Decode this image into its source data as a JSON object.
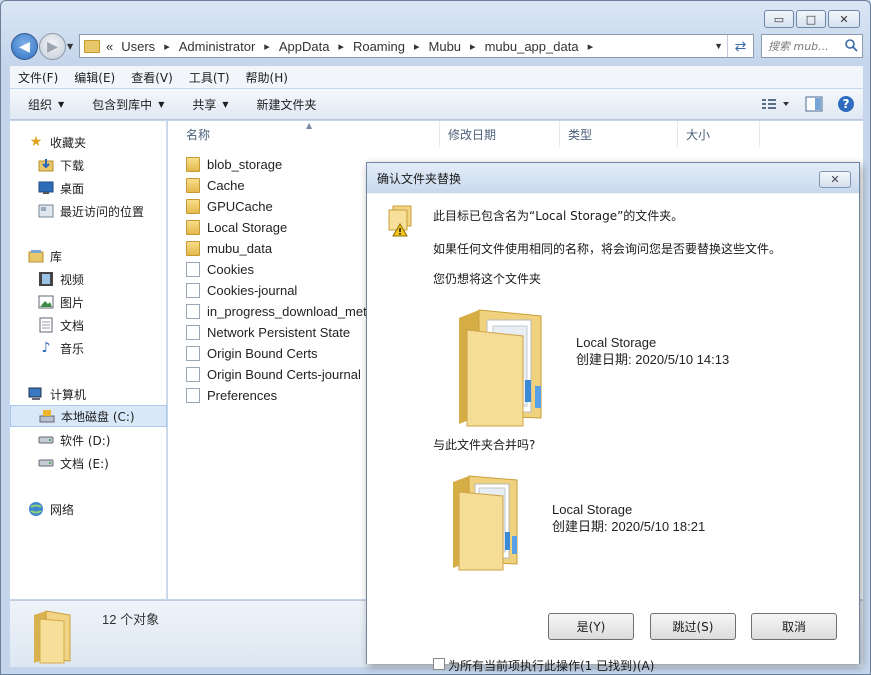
{
  "window": {
    "caption": {
      "minimize": "▭",
      "maximize": "□",
      "close": "✕"
    }
  },
  "address": {
    "overflow": "«",
    "crumbs": [
      "Users",
      "Administrator",
      "AppData",
      "Roaming",
      "Mubu",
      "mubu_app_data"
    ],
    "sep": "▸",
    "search_placeholder": "搜索 mub..."
  },
  "menu": [
    "文件(F)",
    "编辑(E)",
    "查看(V)",
    "工具(T)",
    "帮助(H)"
  ],
  "toolbar": {
    "organize": "组织",
    "include_library": "包含到库中",
    "share": "共享",
    "new_folder": "新建文件夹"
  },
  "nav": {
    "favorites": "收藏夹",
    "downloads": "下载",
    "desktop": "桌面",
    "recent": "最近访问的位置",
    "libraries": "库",
    "videos": "视频",
    "pictures": "图片",
    "documents": "文档",
    "music": "音乐",
    "computer": "计算机",
    "drive_c": "本地磁盘 (C:)",
    "drive_d": "软件 (D:)",
    "drive_e": "文档 (E:)",
    "network": "网络"
  },
  "columns": {
    "name": "名称",
    "modified": "修改日期",
    "type": "类型",
    "size": "大小"
  },
  "files": [
    {
      "name": "blob_storage",
      "kind": "folder"
    },
    {
      "name": "Cache",
      "kind": "folder"
    },
    {
      "name": "GPUCache",
      "kind": "folder"
    },
    {
      "name": "Local Storage",
      "kind": "folder"
    },
    {
      "name": "mubu_data",
      "kind": "folder"
    },
    {
      "name": "Cookies",
      "kind": "file"
    },
    {
      "name": "Cookies-journal",
      "kind": "file"
    },
    {
      "name": "in_progress_download_met",
      "kind": "file"
    },
    {
      "name": "Network Persistent State",
      "kind": "file"
    },
    {
      "name": "Origin Bound Certs",
      "kind": "file"
    },
    {
      "name": "Origin Bound Certs-journal",
      "kind": "file"
    },
    {
      "name": "Preferences",
      "kind": "file"
    }
  ],
  "status": {
    "count": "12 个对象"
  },
  "dialog": {
    "title": "确认文件夹替换",
    "close": "✕",
    "line1": "此目标已包含名为“Local Storage”的文件夹。",
    "line2": "如果任何文件使用相同的名称，将会询问您是否要替换这些文件。",
    "line3": "您仍想将这个文件夹",
    "dest": {
      "name": "Local Storage",
      "created": "创建日期: 2020/5/10 14:13"
    },
    "merge_question": "与此文件夹合并吗?",
    "source": {
      "name": "Local Storage",
      "created": "创建日期: 2020/5/10 18:21"
    },
    "yes": "是(Y)",
    "skip": "跳过(S)",
    "cancel": "取消",
    "apply_all": "为所有当前项执行此操作(1 已找到)(A)"
  },
  "colors": {
    "accent": "#3b6aa8",
    "folder": "#e8c76a"
  }
}
